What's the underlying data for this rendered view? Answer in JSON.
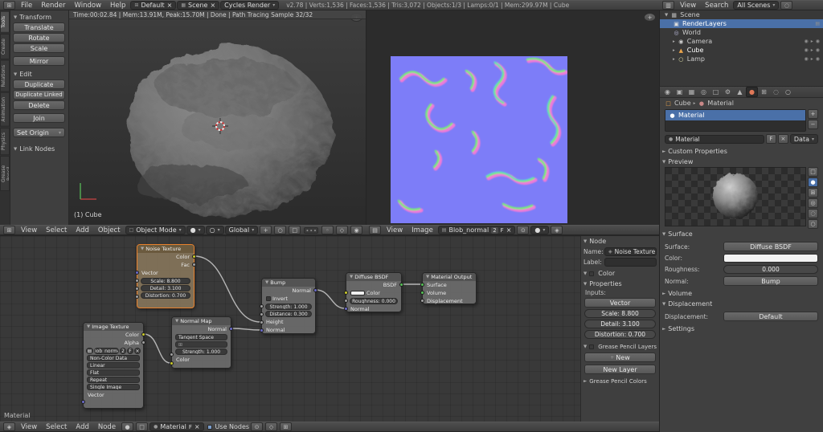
{
  "icons": {
    "collapse": "▼",
    "expand": "►",
    "dropdown": "▾",
    "tri": "▸",
    "close": "×",
    "check": "✓",
    "plus": "+",
    "minus": "−",
    "pin": "⊙",
    "camera": "◉",
    "image": "▤",
    "mesh": "▲",
    "material": "●",
    "world": "◎",
    "lamp": "○",
    "scene": "▦",
    "layers": "▣",
    "wrench": "⚙",
    "grid": "⊞",
    "node": "◈",
    "list": "▥",
    "search": "◌",
    "magnet": "◇",
    "circle": "○",
    "square": "□",
    "lock": "◦"
  },
  "top_header": {
    "menus": [
      "File",
      "Render",
      "Window",
      "Help"
    ],
    "layout": "Default",
    "scene": "Scene",
    "engine": "Cycles Render",
    "stats": "v2.78 | Verts:1,536 | Faces:1,536 | Tris:3,072 | Objects:1/3 | Lamps:0/1 | Mem:299.97M | Cube"
  },
  "render_info": "Time:00:02.84 | Mem:13.91M, Peak:15.70M | Done | Path Tracing Sample 32/32",
  "tool_shelf": {
    "tabs": [
      "Tools",
      "Create",
      "Relations",
      "Animation",
      "Physics",
      "Grease Pencil"
    ],
    "transform_title": "Transform",
    "translate": "Translate",
    "rotate": "Rotate",
    "scale": "Scale",
    "mirror": "Mirror",
    "edit_title": "Edit",
    "duplicate": "Duplicate",
    "duplicate_linked": "Duplicate Linked",
    "delete": "Delete",
    "join": "Join",
    "set_origin": "Set Origin",
    "link_title": "Link Nodes"
  },
  "viewport": {
    "label": "(1) Cube",
    "menus": [
      "View",
      "Select",
      "Add",
      "Object"
    ],
    "mode": "Object Mode",
    "orientation": "Global"
  },
  "uv": {
    "menus": [
      "View",
      "Image"
    ],
    "image_name": "Blob_normal",
    "users": "2",
    "fake_user": "F"
  },
  "node_editor": {
    "breadcrumb": "Material",
    "header": {
      "menus": [
        "View",
        "Select",
        "Add",
        "Node"
      ],
      "material": "Material",
      "fake_user": "F",
      "use_nodes": "Use Nodes"
    },
    "noise": {
      "title": "Noise Texture",
      "color": "Color",
      "fac": "Fac",
      "vector": "Vector",
      "scale": "Scale: 8.800",
      "detail": "Detail: 3.100",
      "distortion": "Distortion: 0.700"
    },
    "image": {
      "title": "Image Texture",
      "color": "Color",
      "alpha": "Alpha",
      "name": "Blob_normal",
      "users": "2",
      "fake_user": "F",
      "colorspace": "Non-Color Data",
      "interpolation": "Linear",
      "projection": "Flat",
      "extension": "Repeat",
      "source": "Single Image",
      "vector": "Vector"
    },
    "normalmap": {
      "title": "Normal Map",
      "normal": "Normal",
      "space": "Tangent Space",
      "strength": "Strength: 1.000",
      "color": "Color"
    },
    "bump": {
      "title": "Bump",
      "normal_out": "Normal",
      "invert": "Invert",
      "strength": "Strength: 1.000",
      "distance": "Distance: 0.300",
      "height": "Height",
      "normal_in": "Normal"
    },
    "diffuse": {
      "title": "Diffuse BSDF",
      "bsdf": "BSDF",
      "color": "Color",
      "roughness": "Roughness: 0.000",
      "normal": "Normal"
    },
    "output": {
      "title": "Material Output",
      "surface": "Surface",
      "volume": "Volume",
      "displacement": "Displacement"
    },
    "n_panel": {
      "node_title": "Node",
      "name_label": "Name:",
      "name_value": "Noise Texture",
      "label_label": "Label:",
      "color_title": "Color",
      "properties_title": "Properties",
      "inputs_label": "Inputs:",
      "vector": "Vector",
      "scale": "Scale: 8.800",
      "detail": "Detail: 3.100",
      "distortion": "Distortion: 0.700",
      "gp_layers": "Grease Pencil Layers",
      "new_btn": "New",
      "new_layer": "New Layer",
      "gp_colors": "Grease Pencil Colors"
    }
  },
  "outliner": {
    "menus": [
      "View",
      "Search"
    ],
    "display": "All Scenes",
    "items": [
      "Scene",
      "RenderLayers",
      "World",
      "Camera",
      "Cube",
      "Lamp"
    ]
  },
  "properties": {
    "crumb_object": "Cube",
    "crumb_material": "Material",
    "slot": "Material",
    "name": "Material",
    "fake_user": "F",
    "data_btn": "Data",
    "custom_props": "Custom Properties",
    "preview": "Preview",
    "surface_title": "Surface",
    "surface_label": "Surface:",
    "surface_value": "Diffuse BSDF",
    "color_label": "Color:",
    "roughness_label": "Roughness:",
    "roughness_value": "0.000",
    "normal_label": "Normal:",
    "normal_value": "Bump",
    "volume_title": "Volume",
    "displacement_title": "Displacement",
    "displacement_label": "Displacement:",
    "displacement_value": "Default",
    "settings_title": "Settings"
  }
}
